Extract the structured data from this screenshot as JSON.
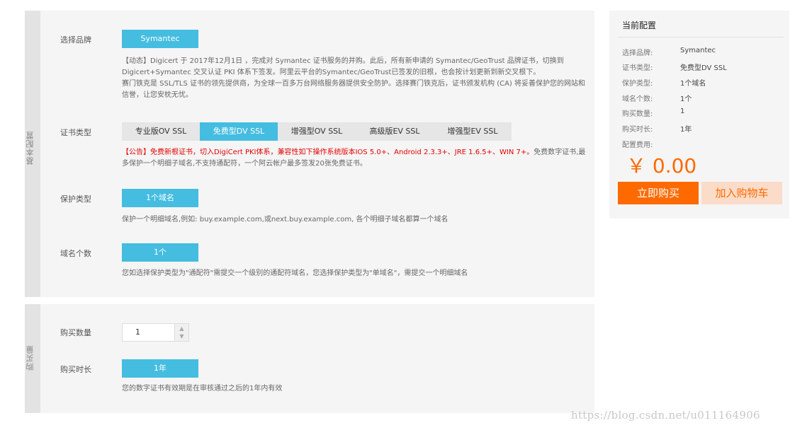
{
  "basic": {
    "side_label": "基本配置",
    "brand": {
      "label": "选择品牌",
      "selected": "Symantec",
      "notice": "【动态】Digicert 于 2017年12月1日 ，完成对 Symantec 证书服务的并购。此后，所有新申请的 Symantec/GeoTrust 品牌证书，切换到 Digicert+Symantec 交叉认证 PKI 体系下签发。阿里云平台的Symantec/GeoTrust已签发的旧根，也会按计划更新到新交叉根下。",
      "intro": "赛门铁克是 SSL/TLS 证书的领先提供商，为全球一百多万台网络服务器提供安全防护。选择赛门铁克后，证书颁发机构 (CA) 将妥善保护您的网站和信誉，让您安枕无忧。"
    },
    "cert_type": {
      "label": "证书类型",
      "options": [
        "专业版OV SSL",
        "免费型DV SSL",
        "增强型OV SSL",
        "高级版EV SSL",
        "增强型EV SSL"
      ],
      "notice_red": "【公告】免费新根证书，切入DigiCert PKI体系，兼容性如下操作系统版本IOS 5.0+、Android 2.3.3+、JRE 1.6.5+、WIN 7+。",
      "notice_gray": "免费数字证书,最多保护一个明细子域名,不支持通配符，一个阿云帐户最多签发20张免费证书。"
    },
    "protection": {
      "label": "保护类型",
      "selected": "1个域名",
      "desc": "保护一个明细域名,例如: buy.example.com,或next.buy.example.com, 各个明细子域名都算一个域名"
    },
    "domain_count": {
      "label": "域名个数",
      "selected": "1个",
      "desc": "您如选择保护类型为\"通配符\"需提交一个级别的通配符域名，您选择保护类型为\"单域名\"，需提交一个明细域名"
    }
  },
  "buy": {
    "side_label": "购买量",
    "quantity": {
      "label": "购买数量",
      "value": "1"
    },
    "duration": {
      "label": "购买时长",
      "selected": "1年",
      "desc": "您的数字证书有效期是在审核通过之后的1年内有效"
    }
  },
  "summary": {
    "title": "当前配置",
    "rows": [
      {
        "label": "选择品牌:",
        "value": "Symantec"
      },
      {
        "label": "证书类型:",
        "value": "免费型DV SSL"
      },
      {
        "label": "保护类型:",
        "value": "1个域名"
      },
      {
        "label": "域名个数:",
        "value": "1个"
      },
      {
        "label": "购买数量:",
        "value": "1"
      },
      {
        "label": "购买时长:",
        "value": "1年"
      }
    ],
    "fee_label": "配置费用:",
    "price": "￥ 0.00",
    "buy_label": "立即购买",
    "cart_label": "加入购物车"
  },
  "watermark": "https://blog.csdn.net/u011164906",
  "colors": {
    "accent": "#44bde0",
    "orange": "#ff6a00",
    "red_notice": "#e40000"
  }
}
